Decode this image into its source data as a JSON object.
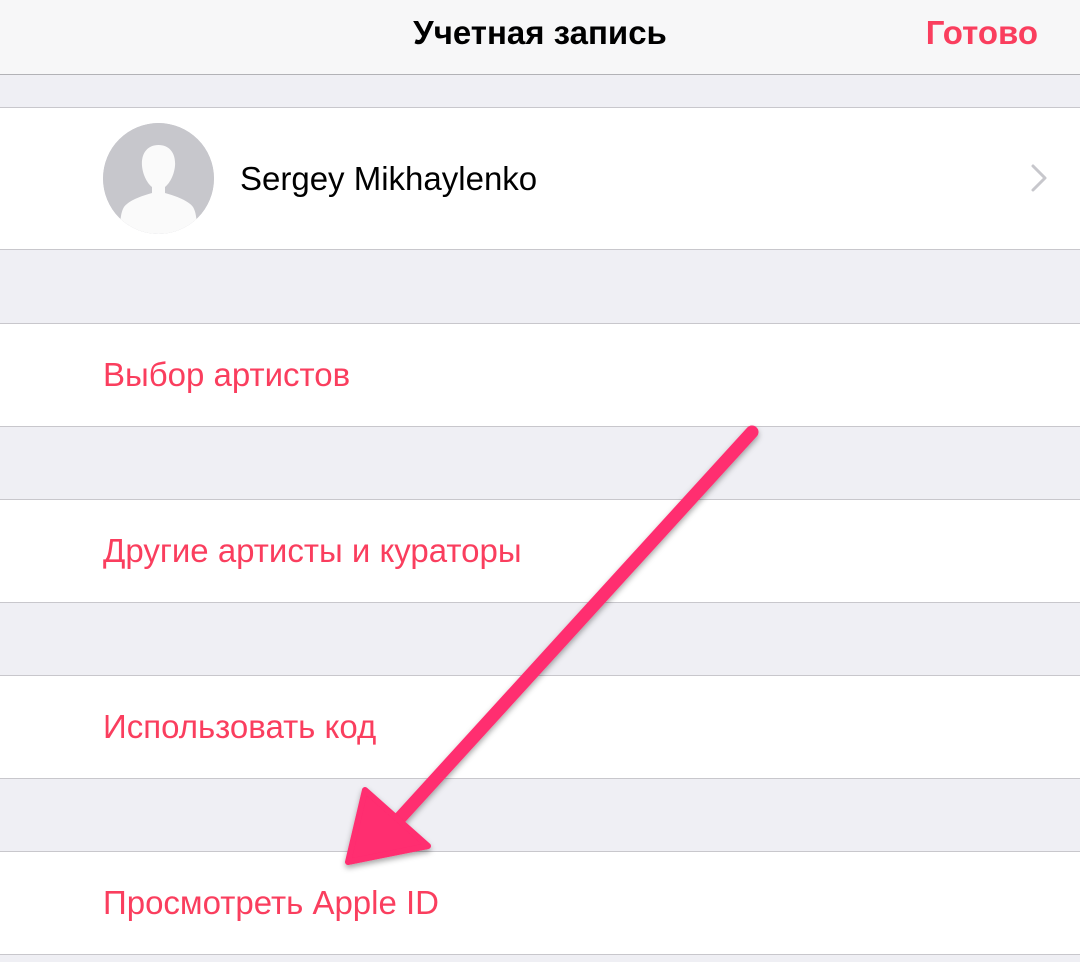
{
  "navbar": {
    "title": "Учетная запись",
    "done_label": "Готово"
  },
  "profile": {
    "name": "Sergey Mikhaylenko",
    "avatar_icon": "person-silhouette-icon",
    "disclosure_icon": "chevron-right-icon"
  },
  "menu": {
    "items": [
      {
        "label": "Выбор артистов"
      },
      {
        "label": "Другие артисты и кураторы"
      },
      {
        "label": "Использовать код"
      },
      {
        "label": "Просмотреть Apple ID"
      }
    ]
  },
  "colors": {
    "accent": "#fa3e5e",
    "annotation_arrow": "#ff2d6f",
    "background": "#efeff4",
    "separator": "#c8c7cc"
  }
}
